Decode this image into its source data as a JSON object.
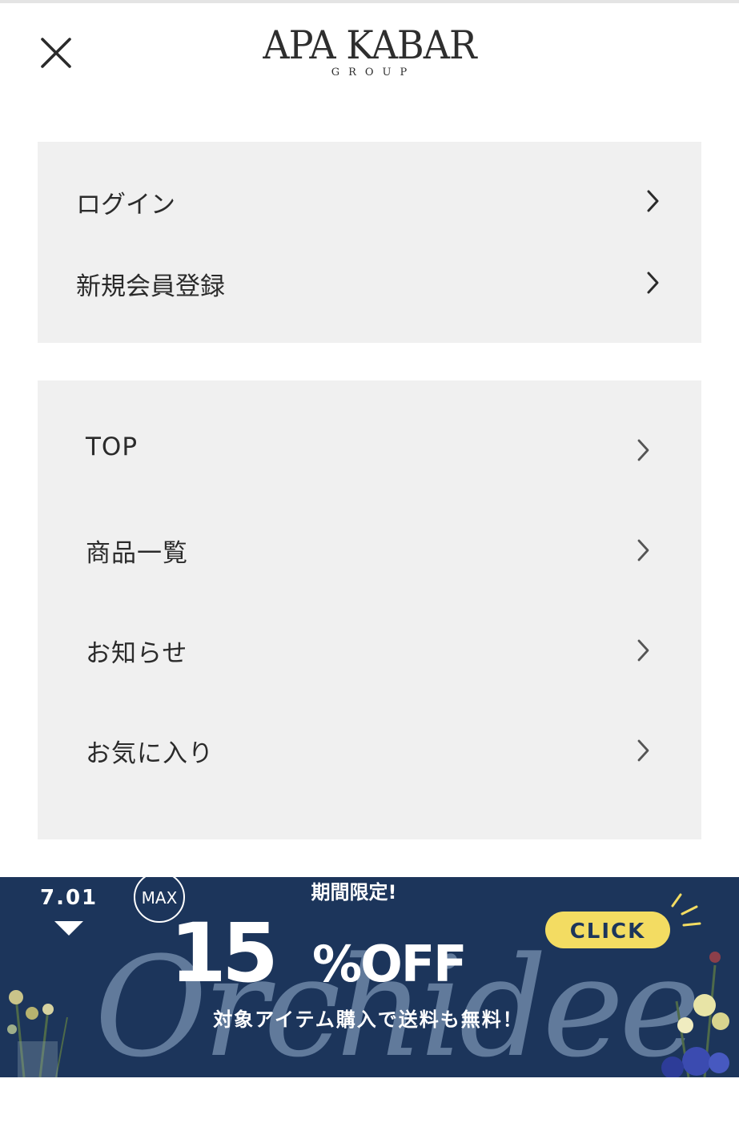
{
  "header": {
    "logo_main": "APA KABAR",
    "logo_sub": "GROUP",
    "close_icon": "close-icon"
  },
  "auth_menu": {
    "items": [
      {
        "label": "ログイン",
        "icon": "chevron-right-icon"
      },
      {
        "label": "新規会員登録",
        "icon": "chevron-right-icon"
      }
    ]
  },
  "nav_menu": {
    "items": [
      {
        "label": "TOP",
        "icon": "chevron-right-icon"
      },
      {
        "label": "商品一覧",
        "icon": "chevron-right-icon"
      },
      {
        "label": "お知らせ",
        "icon": "chevron-right-icon"
      },
      {
        "label": "お気に入り",
        "icon": "chevron-right-icon"
      }
    ]
  },
  "banner": {
    "date": "7.01",
    "max_badge": "MAX",
    "limited": "期間限定!",
    "discount_number": "15",
    "discount_unit": "%OFF",
    "click_label": "CLICK",
    "subtext": "対象アイテム購入で送料も無料！",
    "background_word": "Orchidee",
    "colors": {
      "background": "#1c355b",
      "accent_yellow": "#f3dc62",
      "script_text": "#6e87a7"
    }
  },
  "colors": {
    "panel_bg": "#f0f0f0",
    "text": "#2b2b2b"
  }
}
